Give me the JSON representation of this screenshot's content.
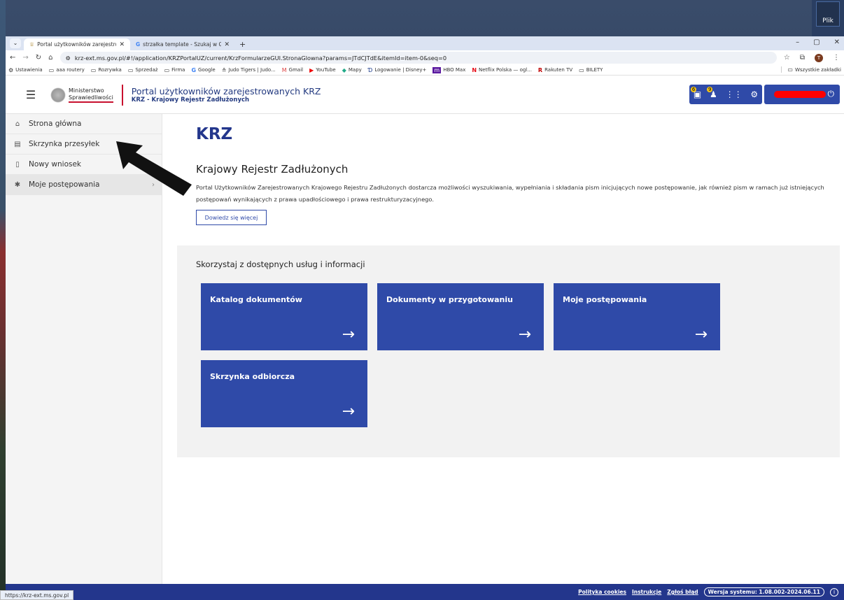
{
  "desktop": {
    "icon_label": "Plik"
  },
  "tabs": [
    {
      "title": "Portal użytkowników zarejestro",
      "active": true
    },
    {
      "title": "strzałka template - Szukaj w Go",
      "active": false
    }
  ],
  "address": {
    "url": "krz-ext.ms.gov.pl/#!/application/KRZPortalUZ/current/KrzFormularzeGUI.StronaGlowna?params=JTdCJTdE&itemId=item-0&seq=0"
  },
  "profile_initial": "T",
  "bookmarks": [
    {
      "icon": "gear-icon",
      "label": "Ustawienia"
    },
    {
      "icon": "folder-icon",
      "label": "aaa routery"
    },
    {
      "icon": "folder-icon",
      "label": "Rozrywka"
    },
    {
      "icon": "folder-icon",
      "label": "Sprzedaż"
    },
    {
      "icon": "folder-icon",
      "label": "Firma"
    },
    {
      "icon": "google-icon",
      "label": "Google"
    },
    {
      "icon": "judo-icon",
      "label": "Judo Tigers | Judo..."
    },
    {
      "icon": "gmail-icon",
      "label": "Gmail"
    },
    {
      "icon": "youtube-icon",
      "label": "YouTube"
    },
    {
      "icon": "maps-icon",
      "label": "Mapy"
    },
    {
      "icon": "disney-icon",
      "label": "Logowanie | Disney+"
    },
    {
      "icon": "hbo-icon",
      "label": "HBO Max"
    },
    {
      "icon": "netflix-icon",
      "label": "Netflix Polska — ogl..."
    },
    {
      "icon": "rakuten-icon",
      "label": "Rakuten TV"
    },
    {
      "icon": "folder-icon",
      "label": "BILETY"
    }
  ],
  "bookmarks_all": "Wszystkie zakładki",
  "header": {
    "ministry_line1": "Ministerstwo",
    "ministry_line2": "Sprawiedliwości",
    "title": "Portal użytkowników zarejestrowanych KRZ",
    "subtitle": "KRZ - Krajowy Rejestr Zadłużonych",
    "badge1": "6",
    "badge2": "9"
  },
  "sidebar": {
    "items": [
      {
        "label": "Strona główna",
        "icon": "home-icon"
      },
      {
        "label": "Skrzynka przesyłek",
        "icon": "inbox-icon"
      },
      {
        "label": "Nowy wniosek",
        "icon": "document-icon"
      },
      {
        "label": "Moje postępowania",
        "icon": "gear-icon"
      }
    ]
  },
  "main": {
    "title": "KRZ",
    "subtitle": "Krajowy Rejestr Zadłużonych",
    "description": "Portal Użytkowników Zarejestrowanych Krajowego Rejestru Zadłużonych dostarcza możliwości wyszukiwania, wypełniania i składania pism inicjujących nowe postępowanie, jak również pism w ramach już istniejących postępowań wynikających z prawa upadłościowego i prawa restrukturyzacyjnego.",
    "learn_more": "Dowiedz się więcej",
    "services_title": "Skorzystaj z dostępnych usług i informacji",
    "tiles": [
      {
        "label": "Katalog dokumentów"
      },
      {
        "label": "Dokumenty w przygotowaniu"
      },
      {
        "label": "Moje postępowania"
      },
      {
        "label": "Skrzynka odbiorcza"
      }
    ]
  },
  "footer": {
    "status_url": "https://krz-ext.ms.gov.pl",
    "cookies": "Polityka cookies",
    "instructions": "Instrukcje",
    "report": "Zgłoś błąd",
    "version": "Wersja systemu: 1.08.002-2024.06.11"
  }
}
